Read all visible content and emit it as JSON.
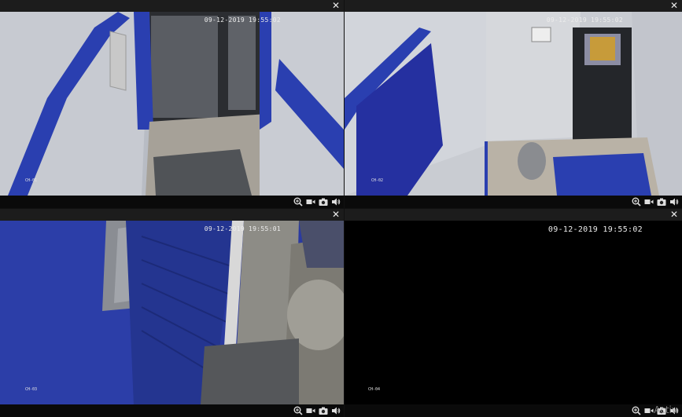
{
  "tiles": [
    {
      "id": "cam1",
      "timestamp": "09-12-2019 19:55:02",
      "camera_label": "CH-01",
      "selected": true
    },
    {
      "id": "cam2",
      "timestamp": "09-12-2019 19:55:02",
      "camera_label": "CH-02",
      "selected": false
    },
    {
      "id": "cam3",
      "timestamp": "09-12-2019 19:55:01",
      "camera_label": "CH-03",
      "selected": false
    },
    {
      "id": "cam4",
      "timestamp": "09-12-2019 19:55:02",
      "camera_label": "CH-04",
      "selected": false
    }
  ],
  "toolbar_icons": [
    "zoom-icon",
    "record-icon",
    "snapshot-icon",
    "audio-icon"
  ],
  "close_glyph": "✕",
  "watermark": "Activ",
  "colors": {
    "selected_border": "#c0283a",
    "wall_blue": "#2a3fb0",
    "background": "#101010"
  }
}
